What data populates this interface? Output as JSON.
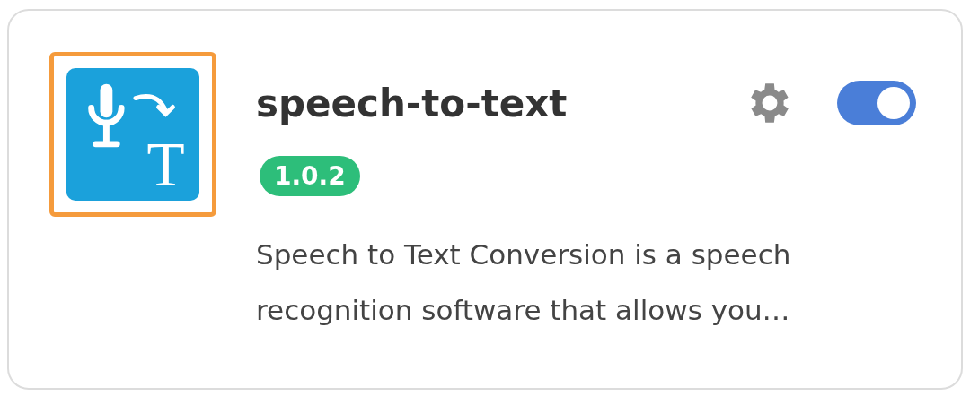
{
  "app": {
    "icon_letter": "T",
    "highlighted": true,
    "name": "speech-to-text",
    "enabled": true,
    "version": "1.0.2",
    "description": "Speech to Text Conversion is a speech recognition software that allows you…"
  }
}
